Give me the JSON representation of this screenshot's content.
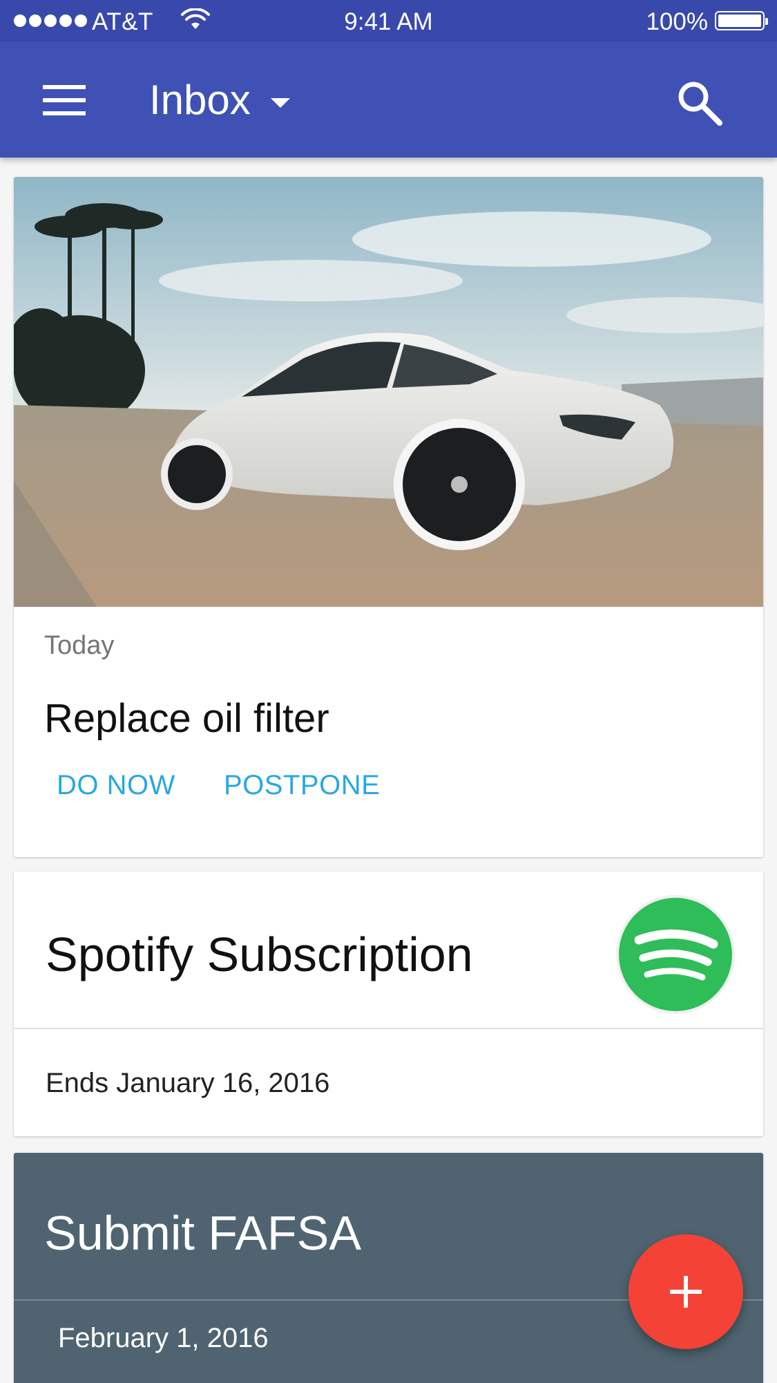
{
  "status_bar": {
    "carrier": "AT&T",
    "time": "9:41 AM",
    "battery": "100%",
    "signal_icon": "signal-dots-icon",
    "wifi_icon": "wifi-icon",
    "battery_icon": "battery-icon"
  },
  "app_bar": {
    "title": "Inbox",
    "menu_icon": "hamburger-menu-icon",
    "dropdown_icon": "caret-down-icon",
    "search_icon": "search-icon",
    "color": "#3f51b5"
  },
  "cards": {
    "oil": {
      "date": "Today",
      "title": "Replace oil filter",
      "do_now": "DO NOW",
      "postpone": "POSTPONE"
    },
    "spotify": {
      "title": "Spotify Subscription",
      "detail": "Ends January 16, 2016",
      "logo_icon": "spotify-logo-icon",
      "logo_color": "#2ebd59"
    },
    "fafsa": {
      "title": "Submit FAFSA",
      "date": "February 1, 2016",
      "color": "#4f6470"
    }
  },
  "fab": {
    "icon": "plus-icon",
    "color": "#f44336"
  },
  "accent_color": "#29a8e0"
}
